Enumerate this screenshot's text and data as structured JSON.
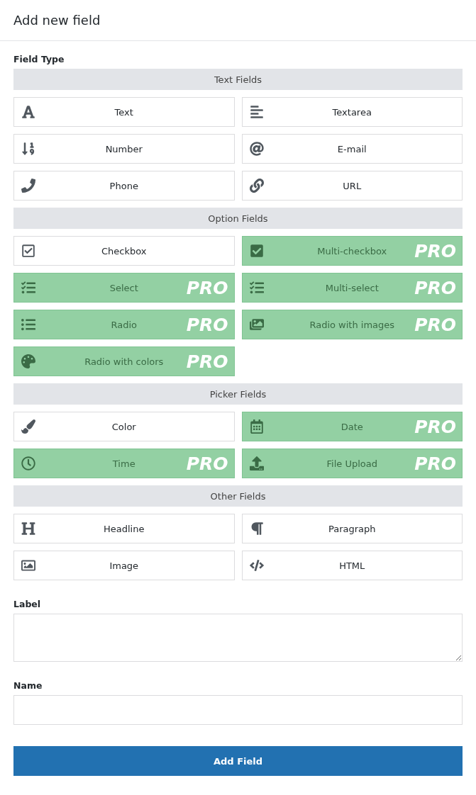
{
  "header": {
    "title": "Add new field"
  },
  "field_type": {
    "label": "Field Type",
    "sections": [
      {
        "title": "Text Fields",
        "items": [
          {
            "label": "Text",
            "pro": false
          },
          {
            "label": "Textarea",
            "pro": false
          },
          {
            "label": "Number",
            "pro": false
          },
          {
            "label": "E-mail",
            "pro": false
          },
          {
            "label": "Phone",
            "pro": false
          },
          {
            "label": "URL",
            "pro": false
          }
        ]
      },
      {
        "title": "Option Fields",
        "items": [
          {
            "label": "Checkbox",
            "pro": false
          },
          {
            "label": "Multi-checkbox",
            "pro": true,
            "badge": "PRO"
          },
          {
            "label": "Select",
            "pro": true,
            "badge": "PRO"
          },
          {
            "label": "Multi-select",
            "pro": true,
            "badge": "PRO"
          },
          {
            "label": "Radio",
            "pro": true,
            "badge": "PRO"
          },
          {
            "label": "Radio with images",
            "pro": true,
            "badge": "PRO"
          },
          {
            "label": "Radio with colors",
            "pro": true,
            "badge": "PRO"
          }
        ]
      },
      {
        "title": "Picker Fields",
        "items": [
          {
            "label": "Color",
            "pro": false
          },
          {
            "label": "Date",
            "pro": true,
            "badge": "PRO"
          },
          {
            "label": "Time",
            "pro": true,
            "badge": "PRO"
          },
          {
            "label": "File Upload",
            "pro": true,
            "badge": "PRO"
          }
        ]
      },
      {
        "title": "Other Fields",
        "items": [
          {
            "label": "Headline",
            "pro": false
          },
          {
            "label": "Paragraph",
            "pro": false
          },
          {
            "label": "Image",
            "pro": false
          },
          {
            "label": "HTML",
            "pro": false
          }
        ]
      }
    ]
  },
  "label_field": {
    "label": "Label"
  },
  "name_field": {
    "label": "Name"
  },
  "submit": {
    "label": "Add Field"
  }
}
